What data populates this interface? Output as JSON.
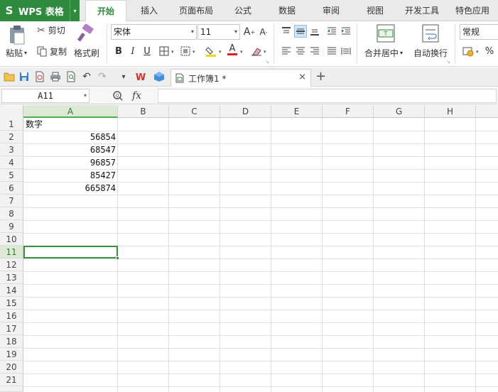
{
  "app": {
    "logo": "S",
    "name": "WPS 表格",
    "menu_arrow": "▾"
  },
  "menu_tabs": [
    {
      "label": "开始",
      "active": true
    },
    {
      "label": "插入"
    },
    {
      "label": "页面布局"
    },
    {
      "label": "公式"
    },
    {
      "label": "数据"
    },
    {
      "label": "审阅"
    },
    {
      "label": "视图"
    },
    {
      "label": "开发工具"
    },
    {
      "label": "特色应用"
    }
  ],
  "ribbon": {
    "paste": "粘贴",
    "cut": "剪切",
    "copy": "复制",
    "format_painter": "格式刷",
    "font_name": "宋体",
    "font_size": "11",
    "bold": "B",
    "italic": "I",
    "underline": "U",
    "font_color_letter": "A",
    "merge_center": "合并居中",
    "wrap_text": "自动换行",
    "number_format": "常规",
    "percent": "%"
  },
  "document_tab": {
    "title": "工作簿1 *",
    "close": "×",
    "new_tab": "+"
  },
  "formula_bar": {
    "cell_ref": "A11",
    "fx": "fx",
    "value": ""
  },
  "sheet": {
    "columns": [
      "A",
      "B",
      "C",
      "D",
      "E",
      "F",
      "G",
      "H"
    ],
    "rows": [
      "1",
      "2",
      "3",
      "4",
      "5",
      "6",
      "7",
      "8",
      "9",
      "10",
      "11",
      "12",
      "13",
      "14",
      "15",
      "16",
      "17",
      "18",
      "19",
      "20",
      "21"
    ],
    "selected_row": "11",
    "selected_col": "A",
    "cells": {
      "A1": "数字",
      "A2": "56854",
      "A3": "68547",
      "A4": "96857",
      "A5": "85427",
      "A6": "665874"
    }
  },
  "colors": {
    "accent": "#2e8b3e",
    "selection": "#3b8e3b"
  }
}
